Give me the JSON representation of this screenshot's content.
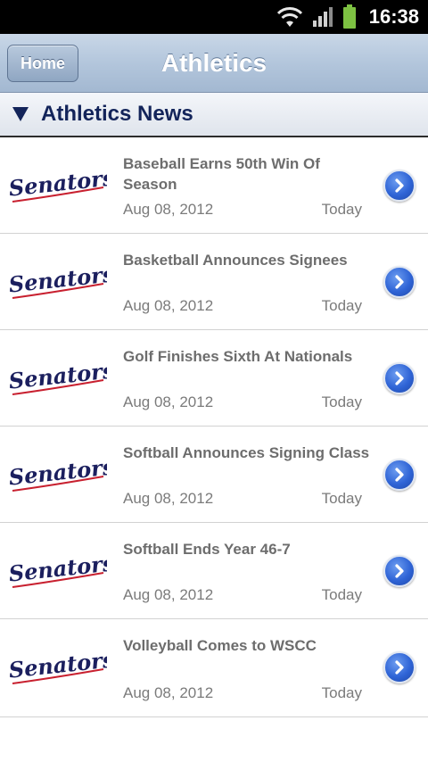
{
  "status_bar": {
    "time": "16:38",
    "icons": [
      "wifi-icon",
      "signal-icon",
      "battery-icon"
    ],
    "battery_color": "#7dc142"
  },
  "header": {
    "home_label": "Home",
    "title": "Athletics"
  },
  "section": {
    "title": "Athletics News"
  },
  "logo_text": "Senators",
  "colors": {
    "header_gradient_top": "#c9d7e7",
    "header_gradient_bottom": "#a3b8d1",
    "section_text": "#13245a",
    "chevron_blue": "#2f64d6",
    "logo_navy": "#1b1f5e",
    "logo_red": "#c8202f"
  },
  "news": [
    {
      "title": "Baseball Earns 50th Win Of Season",
      "date": "Aug 08, 2012",
      "when": "Today"
    },
    {
      "title": "Basketball Announces Signees",
      "date": "Aug 08, 2012",
      "when": "Today"
    },
    {
      "title": "Golf Finishes Sixth At Nationals",
      "date": "Aug 08, 2012",
      "when": "Today"
    },
    {
      "title": "Softball Announces Signing Class",
      "date": "Aug 08, 2012",
      "when": "Today"
    },
    {
      "title": "Softball Ends Year 46-7",
      "date": "Aug 08, 2012",
      "when": "Today"
    },
    {
      "title": "Volleyball Comes to WSCC",
      "date": "Aug 08, 2012",
      "when": "Today"
    }
  ]
}
